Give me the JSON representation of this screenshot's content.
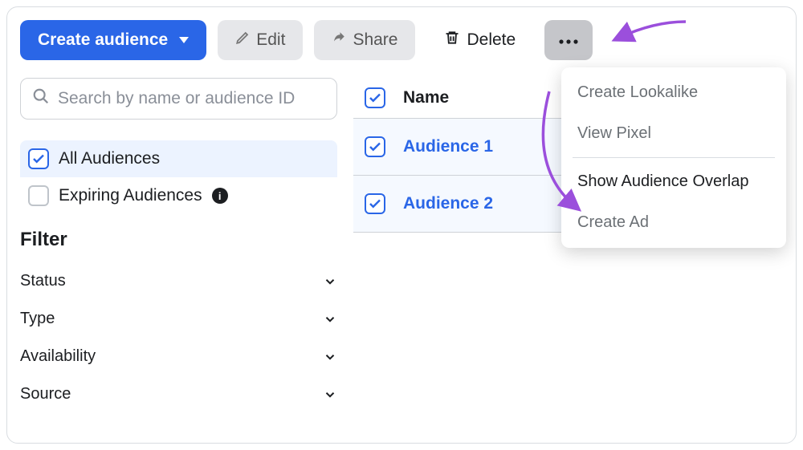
{
  "toolbar": {
    "create_label": "Create audience",
    "edit_label": "Edit",
    "share_label": "Share",
    "delete_label": "Delete"
  },
  "search": {
    "placeholder": "Search by name or audience ID"
  },
  "sidebar": {
    "all_label": "All Audiences",
    "expiring_label": "Expiring Audiences",
    "filter_title": "Filter",
    "filters": {
      "status": "Status",
      "type": "Type",
      "availability": "Availability",
      "source": "Source"
    }
  },
  "table": {
    "header_name": "Name",
    "rows": [
      {
        "name": "Audience 1"
      },
      {
        "name": "Audience 2"
      }
    ]
  },
  "dropdown": {
    "item1": "Create Lookalike",
    "item2": "View Pixel",
    "item3": "Show Audience Overlap",
    "item4": "Create Ad"
  }
}
